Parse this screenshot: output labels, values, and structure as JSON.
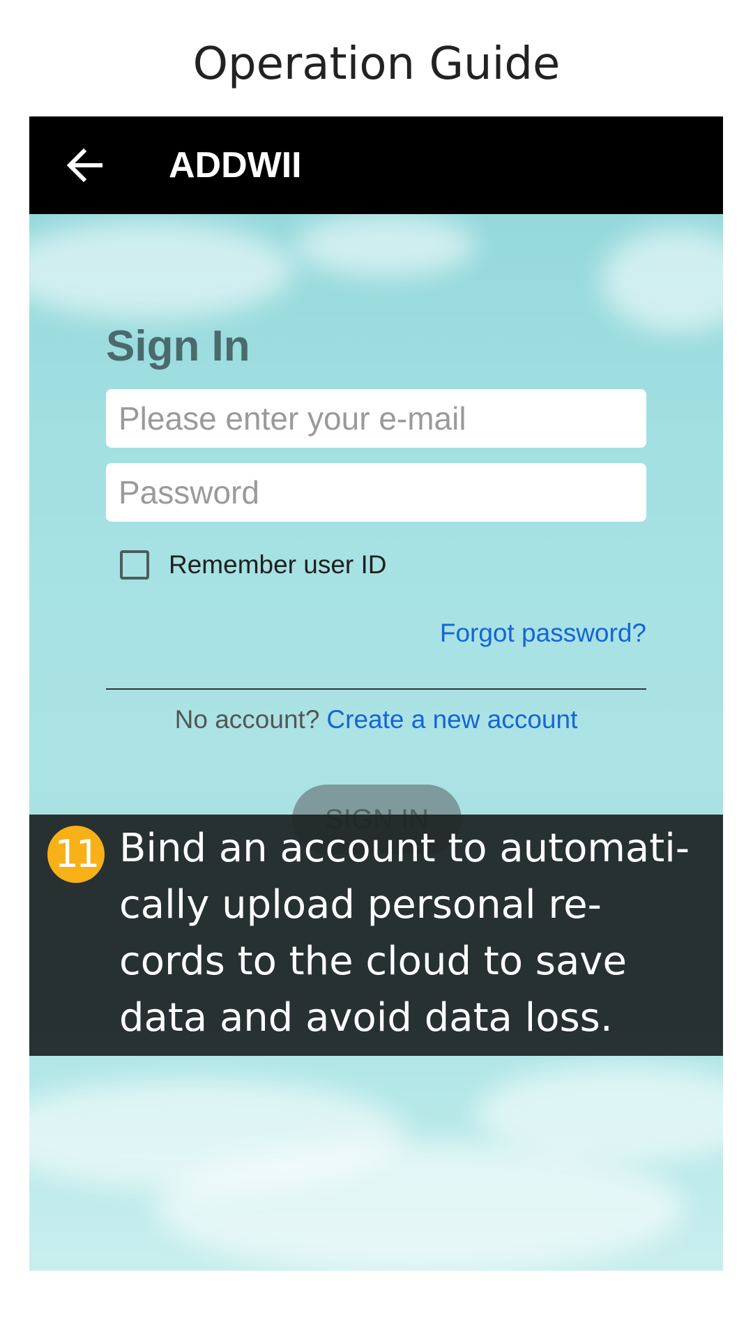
{
  "page": {
    "title": "Operation Guide"
  },
  "appbar": {
    "back_icon": "arrow-left-icon",
    "title": "ADDWII"
  },
  "signin": {
    "heading": "Sign In",
    "email_placeholder": "Please enter your e-mail",
    "email_value": "",
    "password_placeholder": "Password",
    "password_value": "",
    "remember_label": "Remember user ID",
    "remember_checked": false,
    "forgot_label": "Forgot password?",
    "no_account_label": "No account?",
    "create_account_label": "Create a new account",
    "button_label": "SIGN IN"
  },
  "caption": {
    "step_number": "11",
    "text": "Bind an account to automati-\ncally upload personal re-\ncords to the cloud to save\ndata and avoid data loss."
  },
  "colors": {
    "appbar_bg": "#000000",
    "link": "#1565d8",
    "badge": "#f7b117",
    "caption_bg": "#1e2424"
  }
}
